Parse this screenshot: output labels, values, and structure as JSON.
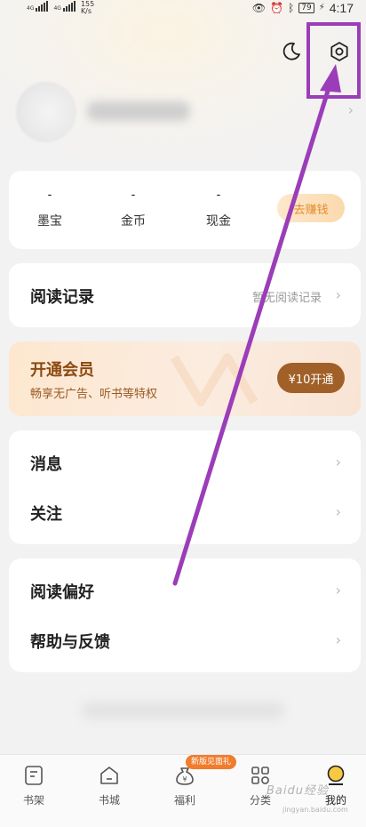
{
  "status_bar": {
    "network_speed": "155",
    "network_speed_unit": "K/s",
    "signal_label_1": "4G",
    "signal_label_2": "4G",
    "battery": "79",
    "time": "4:17"
  },
  "wallet": {
    "items": [
      {
        "value": "-",
        "label": "墨宝"
      },
      {
        "value": "-",
        "label": "金币"
      },
      {
        "value": "-",
        "label": "现金"
      }
    ],
    "earn_button": "去赚钱"
  },
  "history": {
    "title": "阅读记录",
    "hint": "暂无阅读记录"
  },
  "vip": {
    "title": "开通会员",
    "subtitle": "畅享无广告、听书等特权",
    "button": "¥10开通"
  },
  "menu_group_1": [
    {
      "label": "消息"
    },
    {
      "label": "关注"
    }
  ],
  "menu_group_2": [
    {
      "label": "阅读偏好"
    },
    {
      "label": "帮助与反馈"
    }
  ],
  "tabbar": {
    "promo_badge": "新版见面礼",
    "tabs": [
      {
        "label": "书架",
        "icon": "bookshelf-icon"
      },
      {
        "label": "书城",
        "icon": "bookstore-icon"
      },
      {
        "label": "福利",
        "icon": "money-bag-icon"
      },
      {
        "label": "分类",
        "icon": "category-icon"
      },
      {
        "label": "我的",
        "icon": "profile-icon"
      }
    ]
  },
  "watermark": {
    "text": "Baidu经验",
    "url": "jingyan.baidu.com"
  },
  "colors": {
    "accent_orange": "#e48b2a",
    "vip_brown": "#a06028",
    "annotation_purple": "#9b3db8"
  }
}
